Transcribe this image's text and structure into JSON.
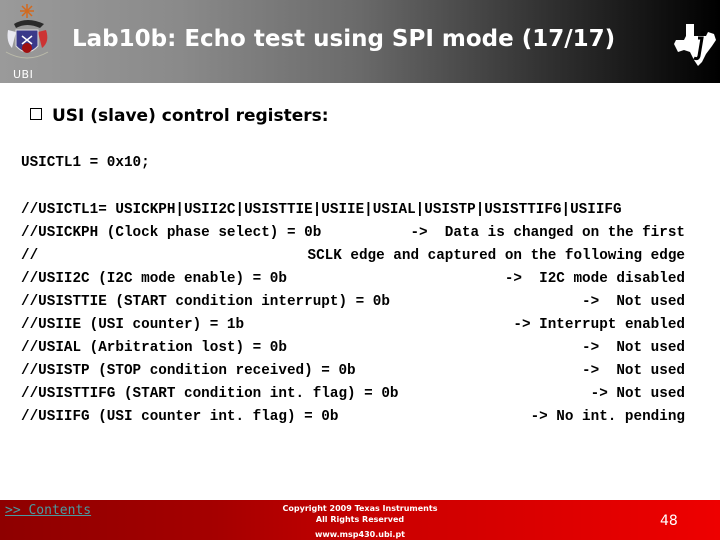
{
  "header": {
    "title": "Lab10b: Echo test using SPI mode (17/17)",
    "org_label": "UBI",
    "left_logo": "ubi-crest-icon",
    "right_logo": "texas-instruments-logo-icon"
  },
  "section": {
    "bullet_icon": "checkbox-bullet-icon",
    "heading": "USI (slave) control registers:"
  },
  "code": {
    "assignment": "USICTL1 = 0x10;",
    "full_comment": "//USICTL1= USICKPH|USII2C|USISTTIE|USIIE|USIAL|USISTP|USISTTIFG|USIIFG",
    "lines": [
      {
        "left": "//USICKPH (Clock phase select) = 0b",
        "right": "->  Data is changed on the first"
      },
      {
        "left": "//",
        "right": "SCLK edge and captured on the following edge"
      },
      {
        "left": "//USII2C (I2C mode enable) = 0b",
        "right": "->  I2C mode disabled"
      },
      {
        "left": "//USISTTIE (START condition interrupt) = 0b",
        "right": "->  Not used"
      },
      {
        "left": "//USIIE (USI counter) = 1b",
        "right": "-> Interrupt enabled"
      },
      {
        "left": "//USIAL (Arbitration lost) = 0b",
        "right": "->  Not used"
      },
      {
        "left": "//USISTP (STOP condition received) = 0b",
        "right": "->  Not used"
      },
      {
        "left": "//USISTTIFG (START condition int. flag) = 0b",
        "right": "-> Not used"
      },
      {
        "left": "//USIIFG (USI counter int. flag) = 0b",
        "right": "-> No int. pending"
      }
    ]
  },
  "footer": {
    "contents_link": ">> Contents",
    "copyright_line1": "Copyright  2009 Texas Instruments",
    "copyright_line2": "All Rights Reserved",
    "url": "www.msp430.ubi.pt",
    "page_number": "48"
  },
  "colors": {
    "footer_red": "#cc0000",
    "link_teal": "#4a9aa0"
  }
}
